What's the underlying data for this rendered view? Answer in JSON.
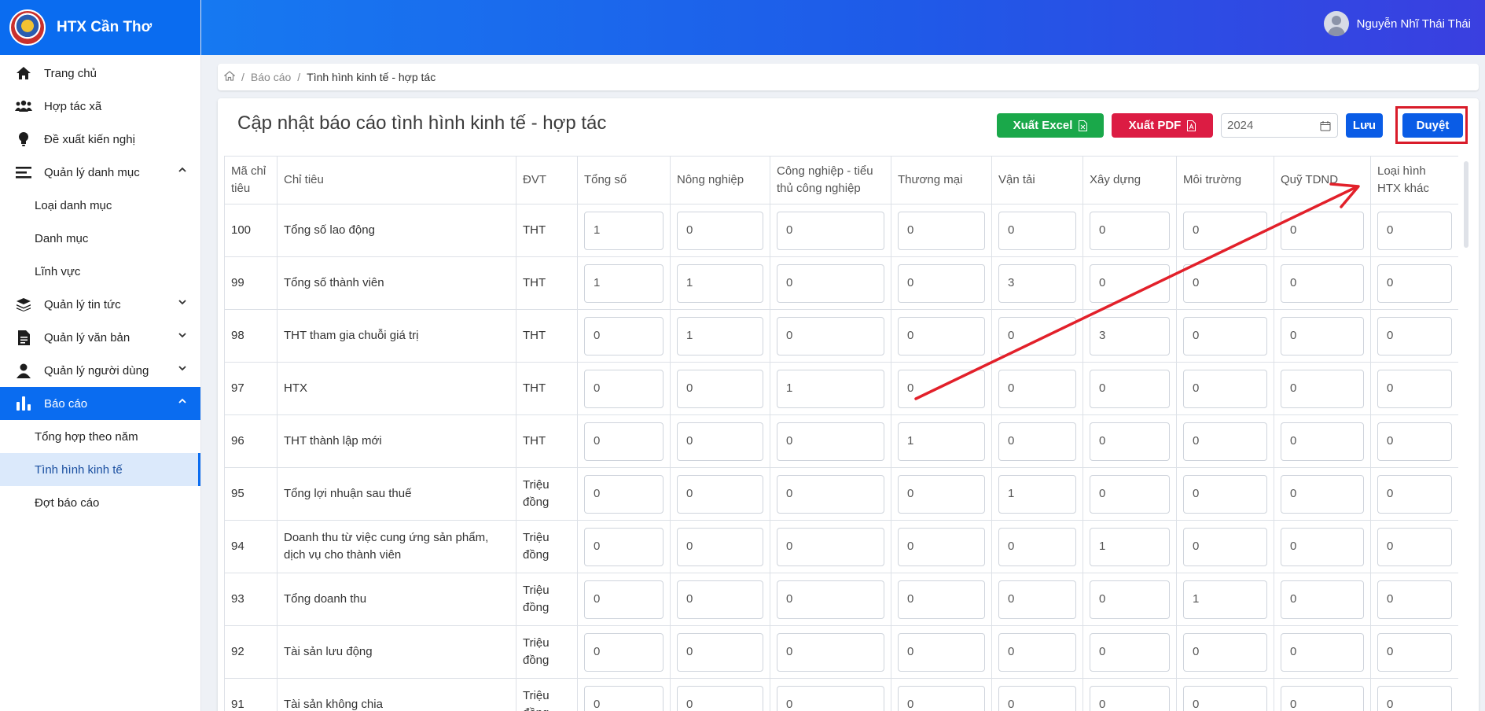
{
  "brand": {
    "name": "HTX Cần Thơ"
  },
  "user": {
    "name": "Nguyễn Nhĩ Thái Thái"
  },
  "sidebar": {
    "items": [
      {
        "label": "Trang chủ",
        "icon": "home-icon"
      },
      {
        "label": "Hợp tác xã",
        "icon": "users-icon"
      },
      {
        "label": "Đề xuất kiến nghị",
        "icon": "lightbulb-icon"
      },
      {
        "label": "Quản lý danh mục",
        "icon": "menu-icon"
      },
      {
        "label": "Loại danh mục"
      },
      {
        "label": "Danh mục"
      },
      {
        "label": "Lĩnh vực"
      },
      {
        "label": "Quản lý tin tức",
        "icon": "layers-icon"
      },
      {
        "label": "Quản lý văn bản",
        "icon": "document-icon"
      },
      {
        "label": "Quản lý người dùng",
        "icon": "user-icon"
      },
      {
        "label": "Báo cáo",
        "icon": "bar-chart-icon"
      },
      {
        "label": "Tổng hợp theo năm"
      },
      {
        "label": "Tình hình kinh tế"
      },
      {
        "label": "Đợt báo cáo"
      }
    ]
  },
  "breadcrumb": {
    "reports": "Báo cáo",
    "current": "Tình hình kinh tế - hợp tác"
  },
  "page": {
    "title": "Cập nhật báo cáo tình hình kinh tế - hợp tác",
    "export_excel": "Xuất Excel",
    "export_pdf": "Xuất PDF",
    "year": "2024",
    "save": "Lưu",
    "approve": "Duyệt"
  },
  "table": {
    "headers": [
      "Mã chỉ tiêu",
      "Chỉ tiêu",
      "ĐVT",
      "Tổng số",
      "Nông nghiệp",
      "Công nghiệp - tiểu thủ công nghiệp",
      "Thương mại",
      "Vận tải",
      "Xây dựng",
      "Môi trường",
      "Quỹ TDND",
      "Loại hình HTX khác"
    ],
    "rows": [
      {
        "code": "100",
        "name": "Tổng số lao động",
        "unit": "THT",
        "values": [
          "1",
          "0",
          "0",
          "0",
          "0",
          "0",
          "0",
          "0",
          "0"
        ]
      },
      {
        "code": "99",
        "name": "Tổng số thành viên",
        "unit": "THT",
        "values": [
          "1",
          "1",
          "0",
          "0",
          "3",
          "0",
          "0",
          "0",
          "0"
        ]
      },
      {
        "code": "98",
        "name": "THT tham gia chuỗi giá trị",
        "unit": "THT",
        "values": [
          "0",
          "1",
          "0",
          "0",
          "0",
          "3",
          "0",
          "0",
          "0"
        ]
      },
      {
        "code": "97",
        "name": "HTX",
        "unit": "THT",
        "values": [
          "0",
          "0",
          "1",
          "0",
          "0",
          "0",
          "0",
          "0",
          "0"
        ]
      },
      {
        "code": "96",
        "name": "THT thành lập mới",
        "unit": "THT",
        "values": [
          "0",
          "0",
          "0",
          "1",
          "0",
          "0",
          "0",
          "0",
          "0"
        ]
      },
      {
        "code": "95",
        "name": "Tổng lợi nhuận sau thuế",
        "unit": "Triệu đồng",
        "values": [
          "0",
          "0",
          "0",
          "0",
          "1",
          "0",
          "0",
          "0",
          "0"
        ]
      },
      {
        "code": "94",
        "name": "Doanh thu từ việc cung ứng sản phẩm, dịch vụ cho thành viên",
        "unit": "Triệu đồng",
        "values": [
          "0",
          "0",
          "0",
          "0",
          "0",
          "1",
          "0",
          "0",
          "0"
        ]
      },
      {
        "code": "93",
        "name": "Tổng doanh thu",
        "unit": "Triệu đồng",
        "values": [
          "0",
          "0",
          "0",
          "0",
          "0",
          "0",
          "1",
          "0",
          "0"
        ]
      },
      {
        "code": "92",
        "name": "Tài sản lưu động",
        "unit": "Triệu đồng",
        "values": [
          "0",
          "0",
          "0",
          "0",
          "0",
          "0",
          "0",
          "0",
          "0"
        ]
      },
      {
        "code": "91",
        "name": "Tài sản không chia",
        "unit": "Triệu đồng",
        "values": [
          "0",
          "0",
          "0",
          "0",
          "0",
          "0",
          "0",
          "0",
          "0"
        ]
      }
    ]
  }
}
